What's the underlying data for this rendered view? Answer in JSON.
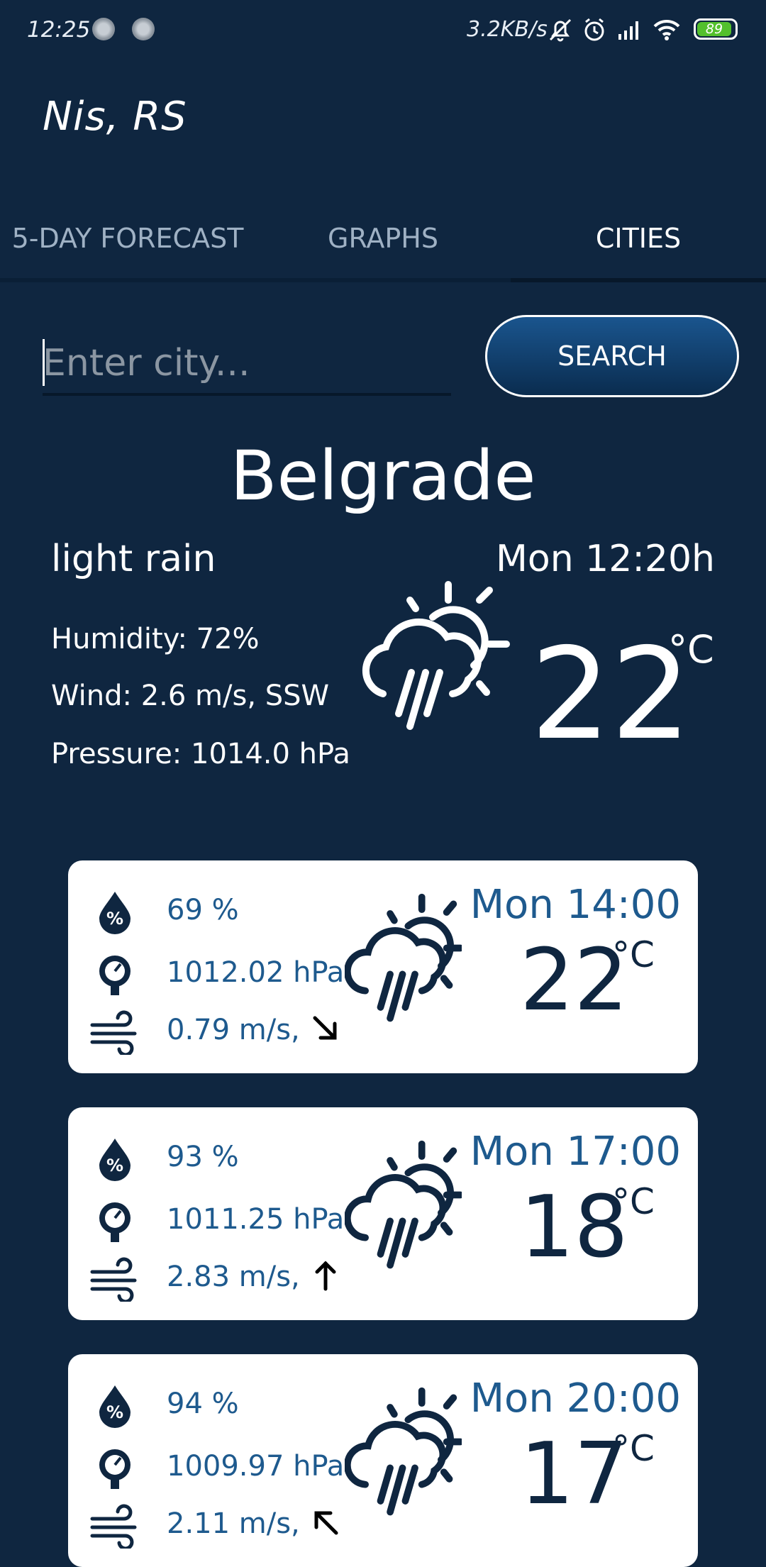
{
  "status_bar": {
    "time": "12:25",
    "speed": "3.2KB/s",
    "battery": "89",
    "icons": [
      "mute-bell-icon",
      "alarm-icon",
      "signal-icon",
      "wifi-icon",
      "battery-icon"
    ]
  },
  "app": {
    "title": "Nis, RS"
  },
  "tabs": [
    {
      "label": "5-DAY FORECAST"
    },
    {
      "label": "GRAPHS"
    },
    {
      "label": "CITIES"
    }
  ],
  "search": {
    "placeholder": "Enter city...",
    "value": "",
    "button_label": "SEARCH"
  },
  "current": {
    "city": "Belgrade",
    "description": "light rain",
    "datetime": "Mon 12:20h",
    "humidity": "Humidity: 72%",
    "wind": "Wind: 2.6 m/s, SSW",
    "pressure": "Pressure: 1014.0 hPa",
    "temperature": "22",
    "unit": "°C",
    "icon": "rain-sun-icon"
  },
  "forecast": [
    {
      "time": "Mon 14:00",
      "temp": "22",
      "unit": "°C",
      "humidity": "69 %",
      "pressure": "1012.02 hPa",
      "wind": "0.79 m/s,",
      "wind_dir": "southeast"
    },
    {
      "time": "Mon 17:00",
      "temp": "18",
      "unit": "°C",
      "humidity": "93 %",
      "pressure": "1011.25 hPa",
      "wind": "2.83 m/s,",
      "wind_dir": "north"
    },
    {
      "time": "Mon 20:00",
      "temp": "17",
      "unit": "°C",
      "humidity": "94 %",
      "pressure": "1009.97 hPa",
      "wind": "2.11 m/s,",
      "wind_dir": "northwest"
    }
  ],
  "colors": {
    "background": "#0f2640",
    "accent": "#1e5a8e",
    "card": "#ffffff"
  }
}
